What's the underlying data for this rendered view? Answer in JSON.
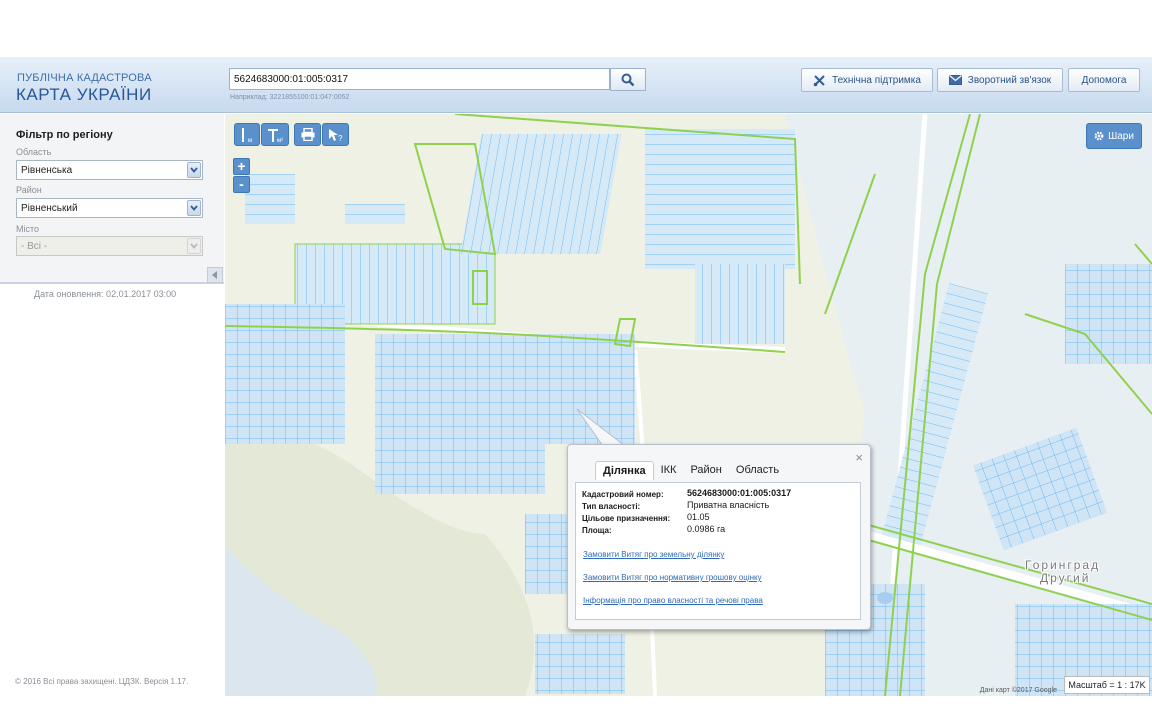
{
  "header": {
    "brand_top": "ПУБЛІЧНА КАДАСТРОВА",
    "brand_main": "КАРТА УКРАЇНИ",
    "search_value": "5624683000:01:005:0317",
    "search_hint": "Наприклад: 3221855100:01:047:0052",
    "buttons": {
      "support": "Технічна підтримка",
      "feedback": "Зворотний зв'язок",
      "help": "Допомога"
    }
  },
  "sidebar": {
    "filter_title": "Фільтр по регіону",
    "region_label": "Область",
    "region_value": "Рівненська",
    "district_label": "Район",
    "district_value": "Рівненський",
    "city_label": "Місто",
    "city_value": "- Всі -",
    "updated": "Дата оновлення: 02.01.2017 03:00",
    "copyright": "© 2016 Всі права захищені. ЦДЗК. Версія 1.17."
  },
  "map": {
    "tools": [
      "ruler-icon",
      "area-measure-icon",
      "print-icon",
      "identify-icon"
    ],
    "zoom_in": "+",
    "zoom_out": "-",
    "layers_label": "Шари",
    "town_line1": "Горинград",
    "town_line2": "Другий",
    "credit": "Дані карт ©2017 Google",
    "scale": "Масштаб = 1 : 17K"
  },
  "popup": {
    "tabs": [
      "Ділянка",
      "ІКК",
      "Район",
      "Область"
    ],
    "active_tab": "Ділянка",
    "rows": [
      {
        "label": "Кадастровий номер:",
        "value": "5624683000:01:005:0317"
      },
      {
        "label": "Тип власності:",
        "value": "Приватна власність"
      },
      {
        "label": "Цільове призначення:",
        "value": "01.05"
      },
      {
        "label": "Площа:",
        "value": "0.0986 га"
      }
    ],
    "links": [
      "Замовити Витяг про земельну ділянку",
      "Замовити Витяг про нормативну грошову оцінку",
      "Інформація про право власності та речові права"
    ],
    "close": "×"
  },
  "colors": {
    "header_bg": "#c7d9ee",
    "brand": "#25579b",
    "parcel_stroke": "#6cbaf0",
    "parcel_fill": "#d3e8f8",
    "boundary": "#8fd14f",
    "tool_button": "#5a90cb",
    "link": "#2f6bb5"
  }
}
